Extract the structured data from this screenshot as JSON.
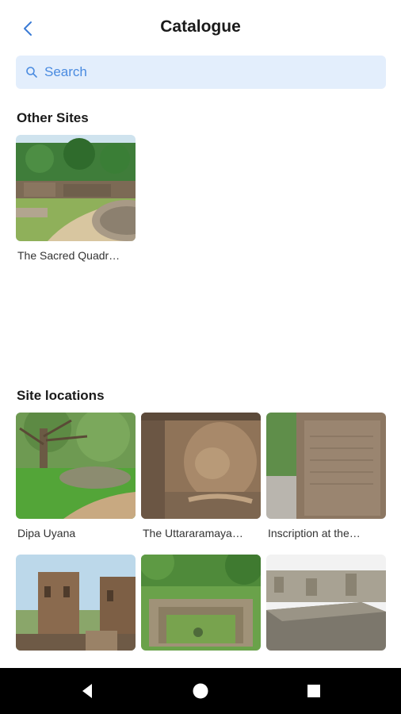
{
  "header": {
    "title": "Catalogue"
  },
  "search": {
    "placeholder": "Search"
  },
  "other_sites": {
    "heading": "Other Sites",
    "items": [
      {
        "label": "The Sacred Quadr…"
      }
    ]
  },
  "site_locations": {
    "heading": "Site locations",
    "items": [
      {
        "label": "Dipa Uyana"
      },
      {
        "label": "The Uttararamaya…"
      },
      {
        "label": "Inscription at the…"
      },
      {
        "label": ""
      },
      {
        "label": ""
      },
      {
        "label": ""
      }
    ]
  },
  "colors": {
    "accent": "#3a7bd5",
    "search_bg": "#e3eefc",
    "navbar": "#000000"
  }
}
